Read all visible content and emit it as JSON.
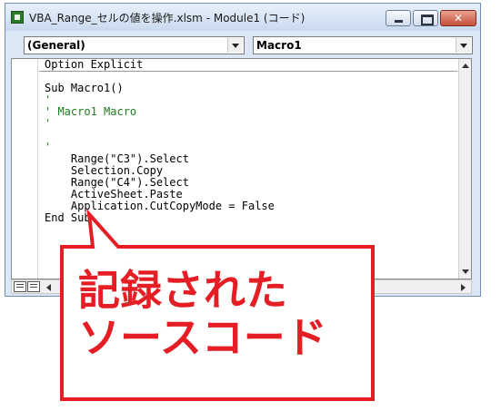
{
  "window": {
    "title": "VBA_Range_セルの値を操作.xlsm - Module1 (コード)",
    "close_label": "✕"
  },
  "comboboxes": {
    "object": "(General)",
    "procedure": "Macro1"
  },
  "code_lines": [
    {
      "text": "Option Explicit",
      "kind": "code"
    },
    {
      "text": "",
      "kind": "code"
    },
    {
      "text": "Sub Macro1()",
      "kind": "code"
    },
    {
      "text": "'",
      "kind": "comment"
    },
    {
      "text": "' Macro1 Macro",
      "kind": "comment"
    },
    {
      "text": "'",
      "kind": "comment"
    },
    {
      "text": "",
      "kind": "code"
    },
    {
      "text": "'",
      "kind": "comment"
    },
    {
      "text": "    Range(\"C3\").Select",
      "kind": "code"
    },
    {
      "text": "    Selection.Copy",
      "kind": "code"
    },
    {
      "text": "    Range(\"C4\").Select",
      "kind": "code"
    },
    {
      "text": "    ActiveSheet.Paste",
      "kind": "code"
    },
    {
      "text": "    Application.CutCopyMode = False",
      "kind": "code"
    },
    {
      "text": "End Sub",
      "kind": "code"
    }
  ],
  "annotation": {
    "line1": "記録された",
    "line2": "ソースコード",
    "color": "#e41e24"
  }
}
